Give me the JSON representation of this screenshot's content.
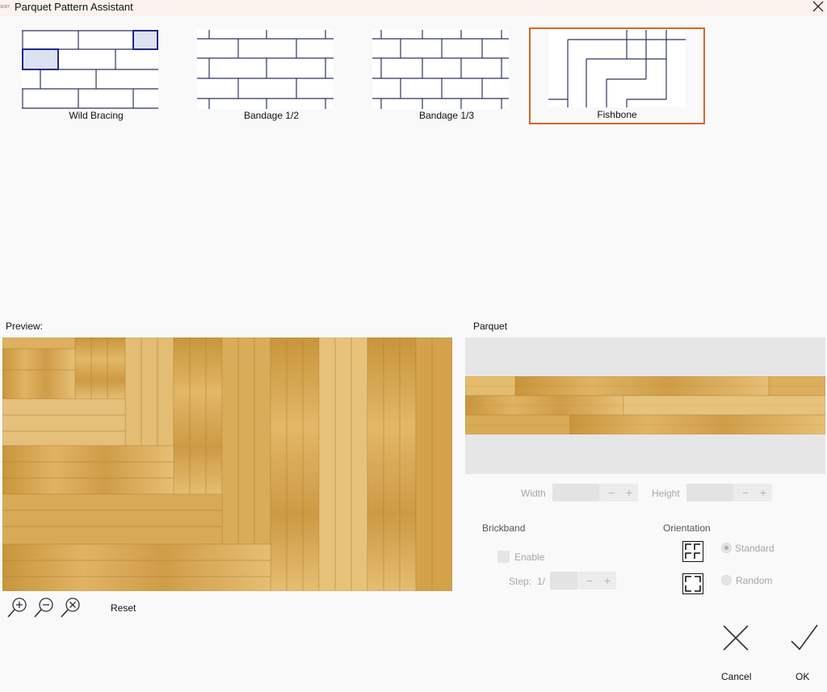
{
  "window": {
    "app_icon_text": "SOFT",
    "title": "Parquet Pattern Assistant",
    "close_icon": "close-icon"
  },
  "patterns": [
    {
      "label": "Wild Bracing",
      "selected": false
    },
    {
      "label": "Bandage 1/2",
      "selected": false
    },
    {
      "label": "Bandage 1/3",
      "selected": false
    },
    {
      "label": "Fishbone",
      "selected": true
    }
  ],
  "preview": {
    "label": "Preview:",
    "zoom_in_icon": "zoom-in-icon",
    "zoom_out_icon": "zoom-out-icon",
    "zoom_reset_icon": "zoom-fit-icon",
    "reset_label": "Reset"
  },
  "parquet": {
    "label": "Parquet",
    "width_label": "Width",
    "width_value": "",
    "height_label": "Height",
    "height_value": "",
    "minus": "−",
    "plus": "+"
  },
  "brickband": {
    "label": "Brickband",
    "enable_label": "Enable",
    "enable_checked": false,
    "step_label": "Step:",
    "step_prefix": "1/",
    "step_value": ""
  },
  "orientation": {
    "label": "Orientation",
    "standard_label": "Standard",
    "random_label": "Random",
    "selected": "Standard",
    "standard_icon": "orientation-standard-icon",
    "random_icon": "orientation-random-icon"
  },
  "actions": {
    "cancel_label": "Cancel",
    "ok_label": "OK",
    "cancel_icon": "cancel-x-icon",
    "ok_icon": "ok-check-icon"
  },
  "colors": {
    "accent_selected": "#d4682a",
    "tile_line": "#2e3560",
    "tile_highlight": "#dbe3f2",
    "wood_light": "#e2b96a",
    "wood_mid": "#d2a04a",
    "wood_dark": "#b9862c",
    "disabled_text": "#a6a6a6"
  }
}
